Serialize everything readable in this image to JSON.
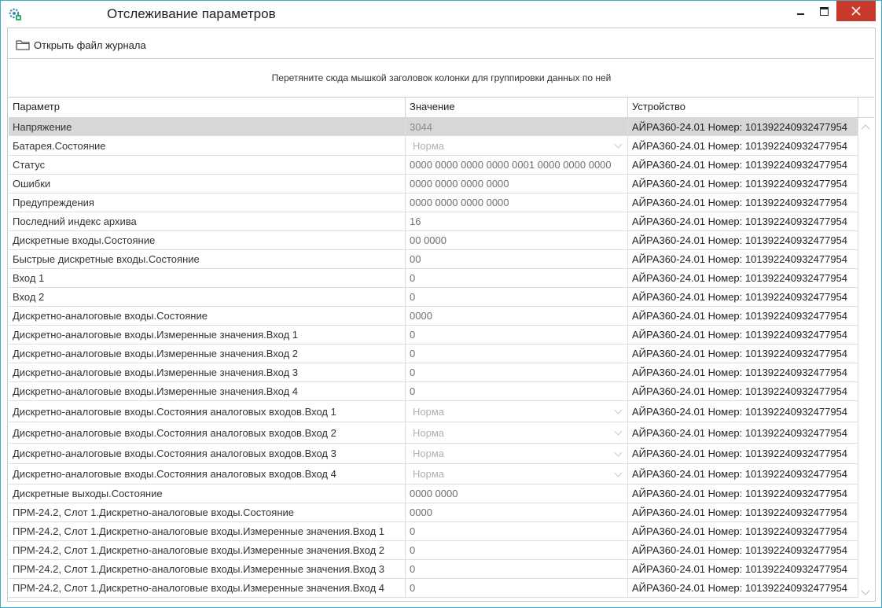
{
  "window": {
    "title": "Отслеживание параметров",
    "icon": "gear-network-icon",
    "controls": [
      "minimize-icon",
      "maximize-icon",
      "close-icon"
    ],
    "close_color": "#c7392b",
    "border_color": "#3ea8c9"
  },
  "toolbar": {
    "open_log_label": "Открыть файл журнала",
    "open_log_icon": "folder-icon"
  },
  "group_panel": {
    "hint": "Перетяните сюда мышкой заголовок колонки для группировки данных по ней"
  },
  "grid": {
    "columns": [
      "Параметр",
      "Значение",
      "Устройство"
    ],
    "rows": [
      {
        "param": "Напряжение",
        "value": "3044",
        "device": "АЙРА360-24.01 Номер: 101392240932477954",
        "dropdown": false,
        "selected": true
      },
      {
        "param": "Батарея.Состояние",
        "value": "Норма",
        "device": "АЙРА360-24.01 Номер: 101392240932477954",
        "dropdown": true
      },
      {
        "param": "Статус",
        "value": "0000 0000 0000 0000 0001 0000 0000 0000",
        "device": "АЙРА360-24.01 Номер: 101392240932477954",
        "dropdown": false
      },
      {
        "param": "Ошибки",
        "value": "0000 0000 0000 0000",
        "device": "АЙРА360-24.01 Номер: 101392240932477954",
        "dropdown": false
      },
      {
        "param": "Предупреждения",
        "value": "0000 0000 0000 0000",
        "device": "АЙРА360-24.01 Номер: 101392240932477954",
        "dropdown": false
      },
      {
        "param": "Последний индекс архива",
        "value": "16",
        "device": "АЙРА360-24.01 Номер: 101392240932477954",
        "dropdown": false
      },
      {
        "param": "Дискретные входы.Состояние",
        "value": "00 0000",
        "device": "АЙРА360-24.01 Номер: 101392240932477954",
        "dropdown": false
      },
      {
        "param": "Быстрые дискретные входы.Состояние",
        "value": "00",
        "device": "АЙРА360-24.01 Номер: 101392240932477954",
        "dropdown": false
      },
      {
        "param": "Вход  1",
        "value": "0",
        "device": "АЙРА360-24.01 Номер: 101392240932477954",
        "dropdown": false
      },
      {
        "param": "Вход  2",
        "value": "0",
        "device": "АЙРА360-24.01 Номер: 101392240932477954",
        "dropdown": false
      },
      {
        "param": "Дискретно-аналоговые входы.Состояние",
        "value": "0000",
        "device": "АЙРА360-24.01 Номер: 101392240932477954",
        "dropdown": false
      },
      {
        "param": "Дискретно-аналоговые входы.Измеренные значения.Вход 1",
        "value": "0",
        "device": "АЙРА360-24.01 Номер: 101392240932477954",
        "dropdown": false
      },
      {
        "param": "Дискретно-аналоговые входы.Измеренные значения.Вход 2",
        "value": "0",
        "device": "АЙРА360-24.01 Номер: 101392240932477954",
        "dropdown": false
      },
      {
        "param": "Дискретно-аналоговые входы.Измеренные значения.Вход 3",
        "value": "0",
        "device": "АЙРА360-24.01 Номер: 101392240932477954",
        "dropdown": false
      },
      {
        "param": "Дискретно-аналоговые входы.Измеренные значения.Вход 4",
        "value": "0",
        "device": "АЙРА360-24.01 Номер: 101392240932477954",
        "dropdown": false
      },
      {
        "param": "Дискретно-аналоговые входы.Состояния аналоговых входов.Вход 1",
        "value": "Норма",
        "device": "АЙРА360-24.01 Номер: 101392240932477954",
        "dropdown": true
      },
      {
        "param": "Дискретно-аналоговые входы.Состояния аналоговых входов.Вход 2",
        "value": "Норма",
        "device": "АЙРА360-24.01 Номер: 101392240932477954",
        "dropdown": true
      },
      {
        "param": "Дискретно-аналоговые входы.Состояния аналоговых входов.Вход 3",
        "value": "Норма",
        "device": "АЙРА360-24.01 Номер: 101392240932477954",
        "dropdown": true
      },
      {
        "param": "Дискретно-аналоговые входы.Состояния аналоговых входов.Вход 4",
        "value": "Норма",
        "device": "АЙРА360-24.01 Номер: 101392240932477954",
        "dropdown": true
      },
      {
        "param": "Дискретные выходы.Состояние",
        "value": "0000 0000",
        "device": "АЙРА360-24.01 Номер: 101392240932477954",
        "dropdown": false
      },
      {
        "param": "ПРМ-24.2, Слот 1.Дискретно-аналоговые входы.Состояние",
        "value": "0000",
        "device": "АЙРА360-24.01 Номер: 101392240932477954",
        "dropdown": false
      },
      {
        "param": "ПРМ-24.2, Слот 1.Дискретно-аналоговые входы.Измеренные значения.Вход 1",
        "value": "0",
        "device": "АЙРА360-24.01 Номер: 101392240932477954",
        "dropdown": false
      },
      {
        "param": "ПРМ-24.2, Слот 1.Дискретно-аналоговые входы.Измеренные значения.Вход 2",
        "value": "0",
        "device": "АЙРА360-24.01 Номер: 101392240932477954",
        "dropdown": false
      },
      {
        "param": "ПРМ-24.2, Слот 1.Дискретно-аналоговые входы.Измеренные значения.Вход 3",
        "value": "0",
        "device": "АЙРА360-24.01 Номер: 101392240932477954",
        "dropdown": false
      },
      {
        "param": "ПРМ-24.2, Слот 1.Дискретно-аналоговые входы.Измеренные значения.Вход 4",
        "value": "0",
        "device": "АЙРА360-24.01 Номер: 101392240932477954",
        "dropdown": false
      }
    ]
  },
  "colors": {
    "selected_row": "#d7d7d7",
    "value_text": "#6e6e6e",
    "dropdown_text": "#b0b0b0",
    "grid_line": "#dedede"
  }
}
